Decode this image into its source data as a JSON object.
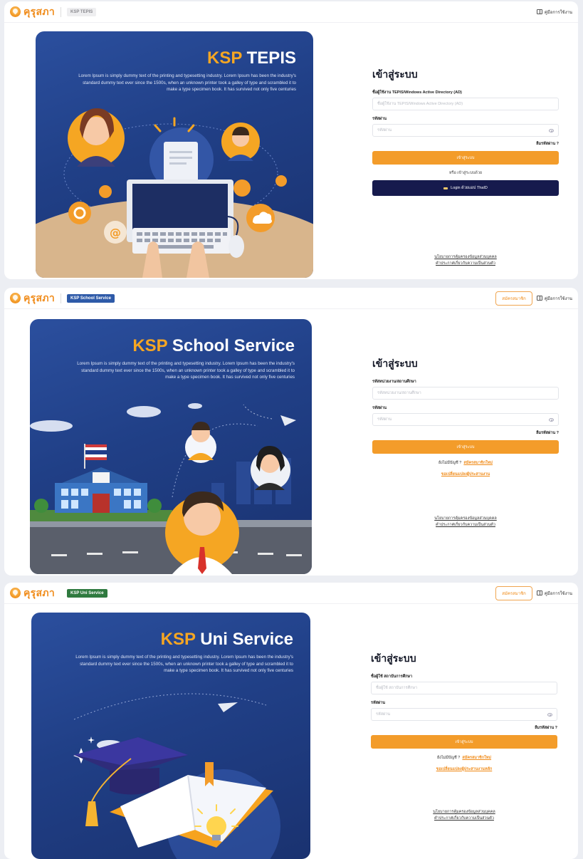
{
  "common": {
    "logo_text": "คุรุสภา",
    "desc": "Lorem Ipsum is simply dummy text of the printing and typesetting industry. Lorem Ipsum has been the industry's standard dummy text ever since the 1500s, when an unknown printer took a galley of type and scrambled it to make a type specimen book. It has survived not only five centuries",
    "login_title": "เข้าสู่ระบบ",
    "password_label": "รหัสผ่าน",
    "password_placeholder": "รหัสผ่าน",
    "forgot": "ลืมรหัสผ่าน ?",
    "login_button": "เข้าสู่ระบบ",
    "policy_line1": "นโยบายการคุ้มครองข้อมูลส่วนบุคคล",
    "policy_line2": "คำประกาศเกี่ยวกับความเป็นส่วนตัว",
    "manual": "คู่มือการใช้งาน"
  },
  "tepis": {
    "badge": "KSP TEPIS",
    "title_accent": "KSP",
    "title_rest": "TEPIS",
    "username_label": "ชื่อผู้ใช้งาน TEPIS/Windows Active Directory (AD)",
    "username_placeholder": "ชื่อผู้ใช้งาน TEPIS/Windows Active Directory (AD)",
    "or_text": "หรือ เข้าสู่ระบบด้วย",
    "thaid_button": "Login ด้วยแอป ThaID",
    "manual": "คู่มือการใช้งาน"
  },
  "school": {
    "badge": "KSP School Service",
    "title_accent": "KSP",
    "title_rest": "School Service",
    "register_button": "สมัครสมาชิก",
    "username_label": "รหัสหน่วยงาน/สถานศึกษา",
    "username_placeholder": "รหัสหน่วยงาน/สถานศึกษา",
    "no_account": "ยังไม่มีบัญชี ?",
    "register_link": "สมัครสมาชิกใหม่",
    "request_link": "ขอเปลี่ยนแปลงผู้ประสานงาน"
  },
  "uni": {
    "badge": "KSP Uni Service",
    "title_accent": "KSP",
    "title_rest": "Uni Service",
    "register_button": "สมัครสมาชิก",
    "username_label": "ชื่อผู้ใช้ สถาบันการศึกษา",
    "username_placeholder": "ชื่อผู้ใช้ สถาบันการศึกษา",
    "no_account": "ยังไม่มีบัญชี ?",
    "register_link": "สมัครสมาชิกใหม่",
    "request_link": "ขอเปลี่ยนแปลงผู้ประสานงานหลัก"
  },
  "colors": {
    "accent": "#f39c2a",
    "navy": "#161a4d",
    "hero": "#203f86",
    "school_badge": "#2e5aa8",
    "uni_badge": "#2f7a3f"
  }
}
